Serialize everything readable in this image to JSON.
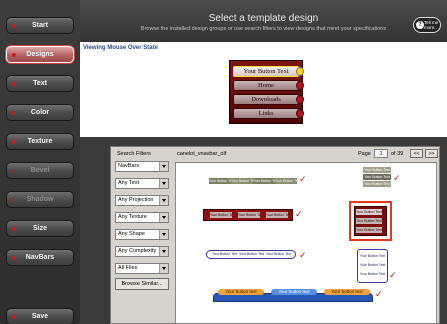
{
  "sidebar": {
    "items": [
      {
        "label": "Start",
        "state": "normal"
      },
      {
        "label": "Designs",
        "state": "active"
      },
      {
        "label": "Text",
        "state": "normal"
      },
      {
        "label": "Color",
        "state": "normal"
      },
      {
        "label": "Texture",
        "state": "normal"
      },
      {
        "label": "Bevel",
        "state": "disabled"
      },
      {
        "label": "Shadow",
        "state": "disabled"
      },
      {
        "label": "Size",
        "state": "normal"
      },
      {
        "label": "NavBars",
        "state": "normal"
      }
    ],
    "save_label": "Save"
  },
  "header": {
    "title": "Select a template design",
    "subtitle": "Browse the installed design groups or use search filters to view designs that meet your specifications",
    "help_line1": "Tell me",
    "help_line2": "more.."
  },
  "preview": {
    "state_label": "Viewing Mouse Over State",
    "menu_items": [
      {
        "label": "Your Button Text",
        "hover": true
      },
      {
        "label": "Home",
        "hover": false
      },
      {
        "label": "Downloads",
        "hover": false
      },
      {
        "label": "Links",
        "hover": false
      }
    ]
  },
  "filters": {
    "title": "Search Filters",
    "selects": [
      "NavBars",
      "Any Text",
      "Any Projection",
      "Any Texture",
      "Any Shape",
      "Any Complexity",
      "All Files"
    ],
    "browse_label": "Browse Similar..."
  },
  "browser": {
    "filename": "canelot_vnavbar_olf",
    "page_label": "Page",
    "page_value": "1",
    "page_total": "of 39",
    "prev_label": "<<",
    "next_label": ">>"
  },
  "thumbnails": {
    "button_text": "Your Button Text",
    "button_text_lower": "Your button text"
  },
  "colors": {
    "sidebar_bg": "#3d3d3d",
    "active_button": "#b56363",
    "menu_red": "#7e1414",
    "selection_border": "#e03a1a",
    "check_red": "#d01010"
  }
}
